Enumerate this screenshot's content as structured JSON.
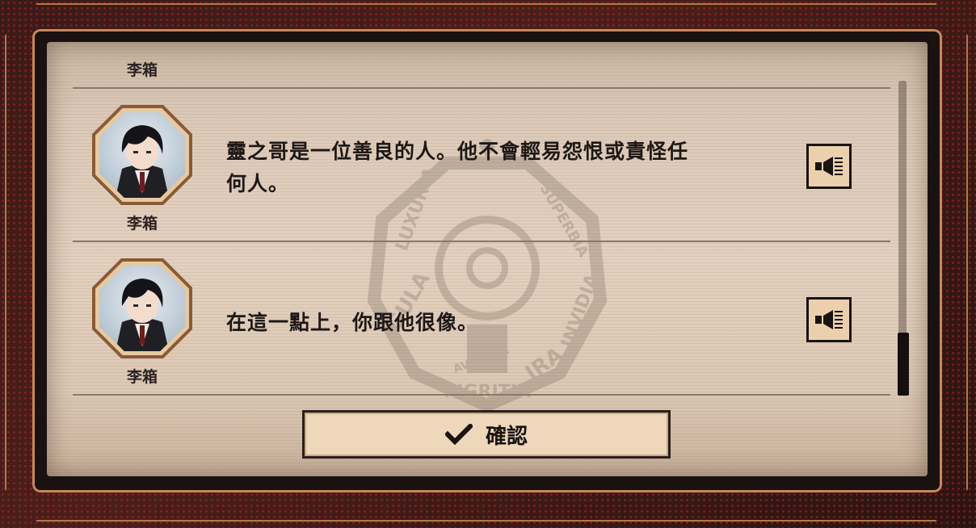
{
  "dialogue_log": {
    "entries": [
      {
        "speaker": "李箱",
        "text": ""
      },
      {
        "speaker": "李箱",
        "text_line1": "靈之哥是一位善良的人。他不會輕易怨恨或責怪任",
        "text_line2": "何人。"
      },
      {
        "speaker": "李箱",
        "text": "在這一點上，你跟他很像。"
      }
    ]
  },
  "confirm_button": {
    "label": "確認",
    "icon": "checkmark-icon"
  },
  "voice_button_icon": "speaker-icon",
  "emblem": {
    "words": [
      "LUXURIA",
      "GULA",
      "AVARITIA",
      "PIGRITIA",
      "IRA",
      "INVIDIA",
      "SUPERBIA"
    ]
  },
  "colors": {
    "paper": "#e3d0be",
    "frame_accent": "#c8875a",
    "button": "#eed7bb",
    "text": "#1d1816"
  }
}
